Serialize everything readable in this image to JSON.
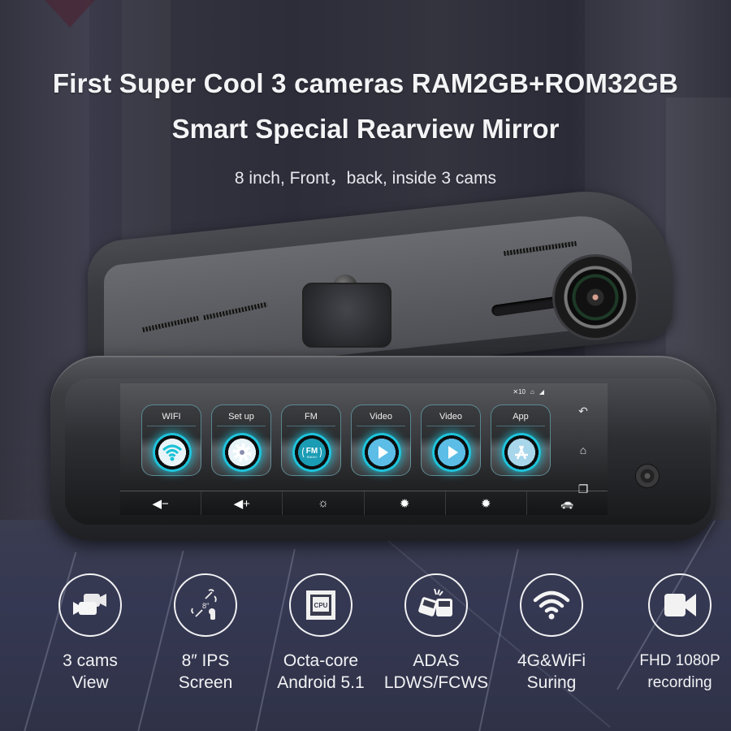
{
  "headline": {
    "line1": "First Super Cool 3 cameras RAM2GB+ROM32GB",
    "line2": "Smart Special Rearview Mirror",
    "subtitle": "8 inch, Front，back, inside 3 cams"
  },
  "screen": {
    "status": {
      "signal_text": "10",
      "icons": [
        "signal-off-icon",
        "home-network-icon",
        "cell-signal-icon"
      ]
    },
    "tiles": [
      {
        "label": "WIFI",
        "icon": "wifi-icon"
      },
      {
        "label": "Set up",
        "icon": "gear-icon"
      },
      {
        "label": "FM",
        "icon": "fm-radio-icon",
        "icon_text": "FM",
        "icon_subtext": "RADIO"
      },
      {
        "label": "Video",
        "icon": "play-icon"
      },
      {
        "label": "Video",
        "icon": "play-icon"
      },
      {
        "label": "App",
        "icon": "app-store-icon"
      }
    ],
    "controls": [
      {
        "name": "volume-down",
        "glyph": "◀−"
      },
      {
        "name": "volume-up",
        "glyph": "◀+"
      },
      {
        "name": "brightness-low",
        "glyph": "☼"
      },
      {
        "name": "brightness-mid",
        "glyph": "✹"
      },
      {
        "name": "brightness-high",
        "glyph": "✹"
      },
      {
        "name": "car-mode",
        "glyph": "🚗"
      }
    ],
    "nav": [
      {
        "name": "back",
        "glyph": "↶"
      },
      {
        "name": "home",
        "glyph": "⌂"
      },
      {
        "name": "recent-apps",
        "glyph": "❐"
      }
    ]
  },
  "features": [
    {
      "icon": "video-cameras-icon",
      "line1": "3 cams",
      "line2": "View"
    },
    {
      "icon": "touch-screen-icon",
      "line1": "8″  IPS",
      "line2": "Screen",
      "icon_text": "8″"
    },
    {
      "icon": "cpu-icon",
      "line1": "Octa-core",
      "line2": "Android 5.1",
      "icon_text": "CPU"
    },
    {
      "icon": "car-collision-icon",
      "line1": "ADAS",
      "line2": "LDWS/FCWS"
    },
    {
      "icon": "wifi-icon",
      "line1": "4G&WiFi",
      "line2": "Suring"
    },
    {
      "icon": "video-camera-icon",
      "line1": "FHD 1080P",
      "line2": "recording"
    }
  ],
  "colors": {
    "accent_cyan": "#1ec4dc",
    "background": "#2f303d",
    "text": "#f4f4f6"
  }
}
